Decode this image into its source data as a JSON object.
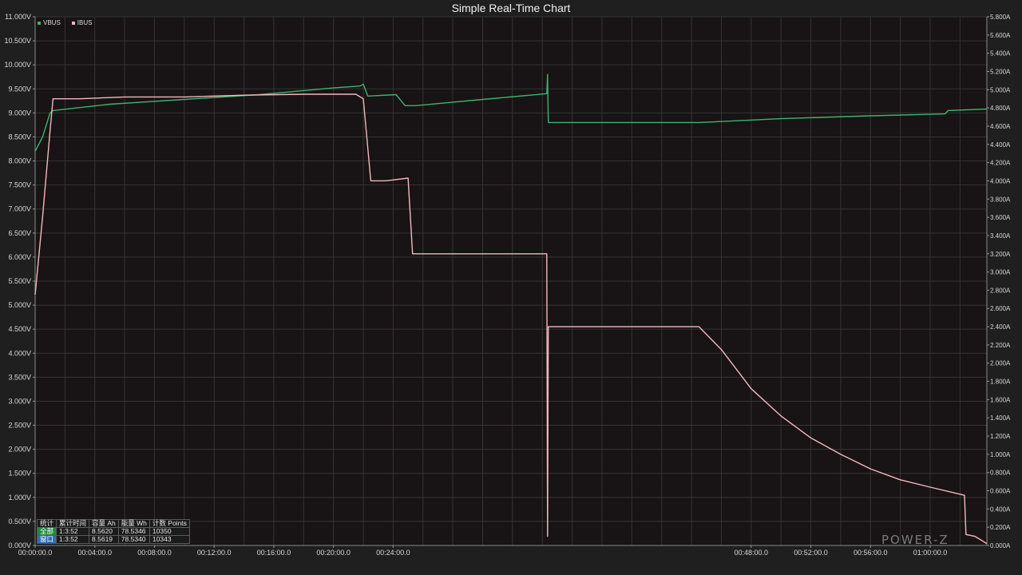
{
  "title": "Simple Real-Time Chart",
  "watermark": "POWER-Z",
  "legend": [
    {
      "name": "VBUS",
      "color": "#3cb371"
    },
    {
      "name": "IBUS",
      "color": "#f4b8c0"
    }
  ],
  "stats_table": {
    "headers": [
      "统计",
      "累计时间",
      "容量 Ah",
      "能量 Wh",
      "计数 Points"
    ],
    "rows": [
      {
        "label": "全部",
        "time": "1:3:52",
        "ah": "8.5620",
        "wh": "78.5346",
        "points": "10350"
      },
      {
        "label": "窗口",
        "time": "1:3:52",
        "ah": "8.5619",
        "wh": "78.5340",
        "points": "10343"
      }
    ]
  },
  "chart_data": {
    "type": "line",
    "title": "Simple Real-Time Chart",
    "xlim": [
      0,
      63.8
    ],
    "x_unit": "minutes",
    "x_ticks": [
      {
        "v": 0,
        "label": "00:00:00.0"
      },
      {
        "v": 4,
        "label": "00:04:00.0"
      },
      {
        "v": 8,
        "label": "00:08:00.0"
      },
      {
        "v": 12,
        "label": "00:12:00.0"
      },
      {
        "v": 16,
        "label": "00:16:00.0"
      },
      {
        "v": 20,
        "label": "00:20:00.0"
      },
      {
        "v": 24,
        "label": "00:24:00.0"
      },
      {
        "v": 48,
        "label": "00:48:00.0"
      },
      {
        "v": 52,
        "label": "00:52:00.0"
      },
      {
        "v": 56,
        "label": "00:56:00.0"
      },
      {
        "v": 60,
        "label": "01:00:00.0"
      }
    ],
    "y_left": {
      "min": 0,
      "max": 11,
      "step": 0.5,
      "unit": "V",
      "ticks": [
        "0.000V",
        "0.500V",
        "1.000V",
        "1.500V",
        "2.000V",
        "2.500V",
        "3.000V",
        "3.500V",
        "4.000V",
        "4.500V",
        "5.000V",
        "5.500V",
        "6.000V",
        "6.500V",
        "7.000V",
        "7.500V",
        "8.000V",
        "8.500V",
        "9.000V",
        "9.500V",
        "10.000V",
        "10.500V",
        "11.000V"
      ]
    },
    "y_right": {
      "min": 0,
      "max": 5.8,
      "step": 0.2,
      "unit": "A",
      "ticks": [
        "0.000A",
        "0.200A",
        "0.400A",
        "0.600A",
        "0.800A",
        "1.000A",
        "1.200A",
        "1.400A",
        "1.600A",
        "1.800A",
        "2.000A",
        "2.200A",
        "2.400A",
        "2.600A",
        "2.800A",
        "3.000A",
        "3.200A",
        "3.400A",
        "3.600A",
        "3.800A",
        "4.000A",
        "4.200A",
        "4.400A",
        "4.600A",
        "4.800A",
        "5.000A",
        "5.200A",
        "5.400A",
        "5.600A",
        "5.800A"
      ]
    },
    "grid": true,
    "legend_position": "top-left",
    "series": [
      {
        "name": "VBUS",
        "axis": "left",
        "color": "#3cb371",
        "points": [
          [
            0,
            8.2
          ],
          [
            0.5,
            8.5
          ],
          [
            1.0,
            9.0
          ],
          [
            1.2,
            9.05
          ],
          [
            5,
            9.18
          ],
          [
            10,
            9.28
          ],
          [
            15,
            9.38
          ],
          [
            20,
            9.52
          ],
          [
            21.8,
            9.56
          ],
          [
            22.0,
            9.6
          ],
          [
            22.3,
            9.35
          ],
          [
            24.2,
            9.38
          ],
          [
            24.8,
            9.15
          ],
          [
            25.5,
            9.15
          ],
          [
            30,
            9.28
          ],
          [
            34.3,
            9.4
          ],
          [
            34.35,
            9.8
          ],
          [
            34.4,
            8.8
          ],
          [
            44.5,
            8.8
          ],
          [
            50,
            8.88
          ],
          [
            56,
            8.94
          ],
          [
            61,
            8.98
          ],
          [
            61.2,
            9.05
          ],
          [
            63.8,
            9.08
          ]
        ]
      },
      {
        "name": "IBUS",
        "axis": "right",
        "color": "#f4b8c0",
        "points": [
          [
            0,
            2.75
          ],
          [
            0.5,
            3.6
          ],
          [
            1.0,
            4.55
          ],
          [
            1.2,
            4.9
          ],
          [
            3,
            4.9
          ],
          [
            6,
            4.92
          ],
          [
            10,
            4.92
          ],
          [
            14,
            4.94
          ],
          [
            18,
            4.95
          ],
          [
            21.5,
            4.95
          ],
          [
            22.0,
            4.9
          ],
          [
            22.5,
            4.0
          ],
          [
            23.5,
            4.0
          ],
          [
            25.0,
            4.03
          ],
          [
            25.3,
            3.2
          ],
          [
            28,
            3.2
          ],
          [
            31,
            3.2
          ],
          [
            34.3,
            3.2
          ],
          [
            34.35,
            0.1
          ],
          [
            34.4,
            2.4
          ],
          [
            38,
            2.4
          ],
          [
            41,
            2.4
          ],
          [
            44.5,
            2.4
          ],
          [
            46,
            2.15
          ],
          [
            48,
            1.72
          ],
          [
            50,
            1.42
          ],
          [
            52,
            1.18
          ],
          [
            54,
            1.0
          ],
          [
            56,
            0.84
          ],
          [
            58,
            0.72
          ],
          [
            60,
            0.64
          ],
          [
            62.3,
            0.55
          ],
          [
            62.4,
            0.12
          ],
          [
            63.0,
            0.1
          ],
          [
            63.8,
            0.02
          ]
        ]
      }
    ]
  }
}
